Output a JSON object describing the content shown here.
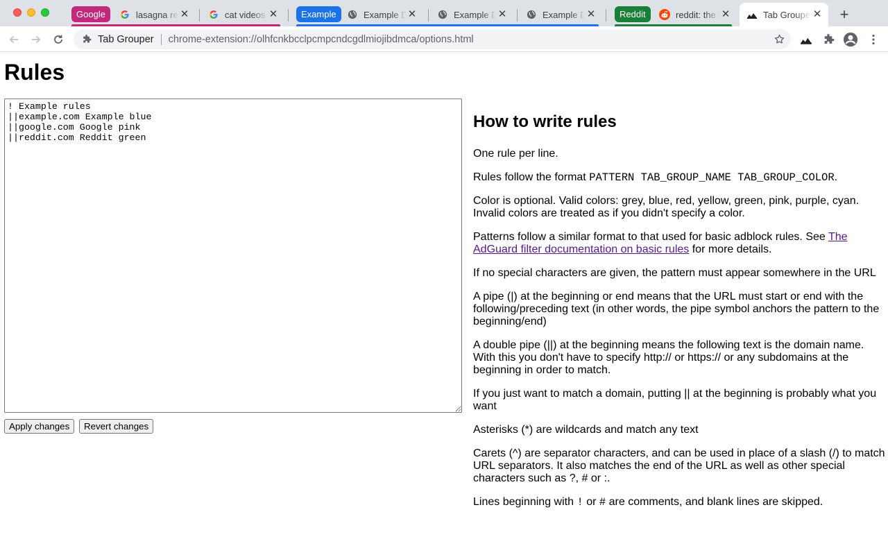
{
  "tabs": {
    "groups": [
      {
        "label": "Google",
        "color": "#c2297c"
      },
      {
        "label": "Example",
        "color": "#1a73e8"
      },
      {
        "label": "Reddit",
        "color": "#188038"
      }
    ],
    "items": [
      {
        "title": "lasagna recipe",
        "icon": "google-g-icon"
      },
      {
        "title": "cat videos",
        "icon": "google-g-icon"
      },
      {
        "title": "Example Domain",
        "icon": "globe-icon"
      },
      {
        "title": "Example Domain",
        "icon": "globe-icon"
      },
      {
        "title": "Example Domain",
        "icon": "globe-icon"
      },
      {
        "title": "reddit: the front page",
        "icon": "reddit-icon"
      },
      {
        "title": "Tab Grouper",
        "icon": "tab-grouper-icon",
        "active": true
      }
    ],
    "close_glyph": "✕",
    "new_tab_glyph": "+"
  },
  "toolbar": {
    "site_name": "Tab Grouper",
    "url": "chrome-extension://olhfcnkbcclpcmpcndcgdlmiojibdmca/options.html"
  },
  "page": {
    "title": "Rules",
    "rules_text": "! Example rules\n||example.com Example blue\n||google.com Google pink\n||reddit.com Reddit green",
    "apply_label": "Apply changes",
    "revert_label": "Revert changes"
  },
  "help": {
    "heading": "How to write rules",
    "p1": "One rule per line.",
    "p2_pre": "Rules follow the format ",
    "p2_code": "PATTERN TAB_GROUP_NAME TAB_GROUP_COLOR",
    "p2_post": ".",
    "p3": "Color is optional. Valid colors: grey, blue, red, yellow, green, pink, purple, cyan. Invalid colors are treated as if you didn't specify a color.",
    "p4_pre": "Patterns follow a similar format to that used for basic adblock rules. See ",
    "p4_link": "The AdGuard filter documentation on basic rules",
    "p4_post": " for more details.",
    "p5": "If no special characters are given, the pattern must appear somewhere in the URL",
    "p6": "A pipe (|) at the beginning or end means that the URL must start or end with the following/preceding text (in other words, the pipe symbol anchors the pattern to the beginning/end)",
    "p7": "A double pipe (||) at the beginning means the following text is the domain name. With this you don't have to specify http:// or https:// or any subdomains at the beginning in order to match.",
    "p8": "If you just want to match a domain, putting || at the beginning is probably what you want",
    "p9": "Asterisks (*) are wildcards and match any text",
    "p10": "Carets (^) are separator characters, and can be used in place of a slash (/) to match URL separators. It also matches the end of the URL as well as other special characters such as ?, # or :.",
    "p11_pre": "Lines beginning with ",
    "p11_code1": "!",
    "p11_mid": " or ",
    "p11_code2": "#",
    "p11_post": " are comments, and blank lines are skipped."
  }
}
